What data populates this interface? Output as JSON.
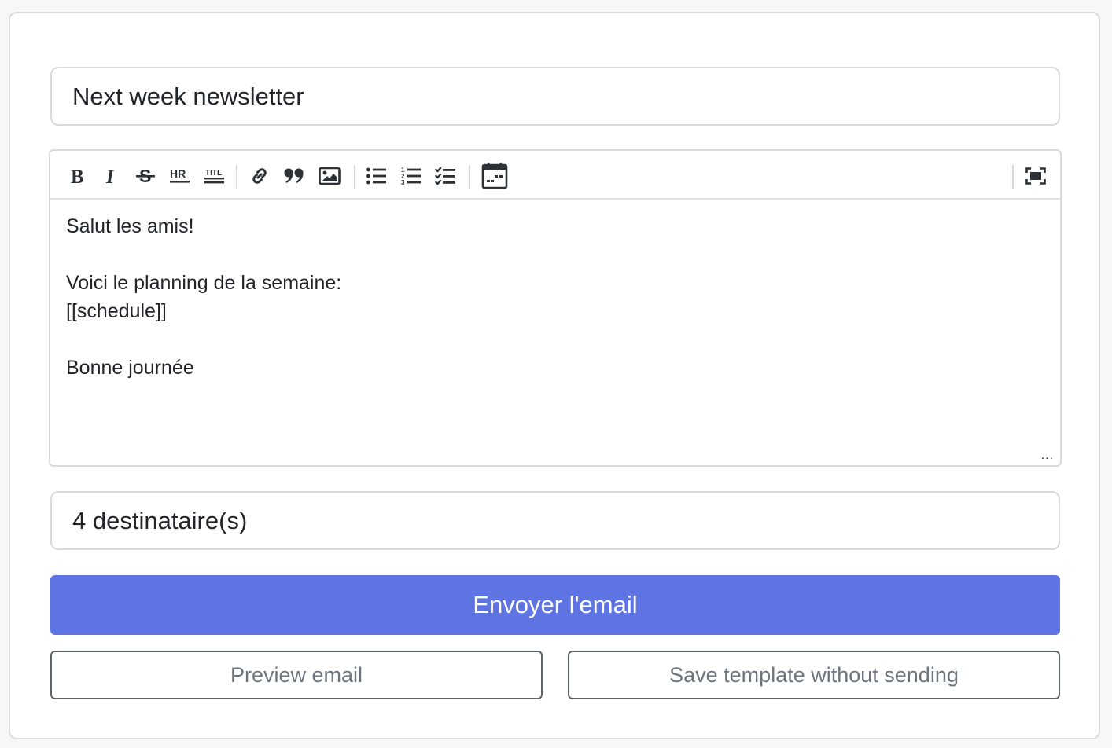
{
  "subject": {
    "value": "Next week newsletter"
  },
  "toolbar": {
    "buttons": [
      {
        "name": "bold-icon",
        "title": "B"
      },
      {
        "name": "italic-icon",
        "title": "I"
      },
      {
        "name": "strikethrough-icon",
        "title": "S"
      },
      {
        "name": "horizontal-rule-icon",
        "title": "HR"
      },
      {
        "name": "title-icon",
        "title": "TITL"
      },
      {
        "name": "link-icon"
      },
      {
        "name": "quote-icon"
      },
      {
        "name": "image-icon"
      },
      {
        "name": "bullet-list-icon"
      },
      {
        "name": "numbered-list-icon"
      },
      {
        "name": "checklist-icon"
      },
      {
        "name": "calendar-icon"
      },
      {
        "name": "fullscreen-icon"
      }
    ],
    "hr_label": "HR",
    "title_label": "TITL"
  },
  "editor": {
    "content": "Salut les amis!\n\nVoici le planning de la semaine:\n[[schedule]]\n\nBonne journée",
    "resize_glyph": "..."
  },
  "recipients": {
    "value": "4 destinataire(s)"
  },
  "actions": {
    "send_label": "Envoyer l'email",
    "preview_label": "Preview email",
    "save_label": "Save template without sending"
  },
  "colors": {
    "primary": "#5f74e3",
    "secondary_text": "#6c757d",
    "border": "#d7dadd"
  }
}
